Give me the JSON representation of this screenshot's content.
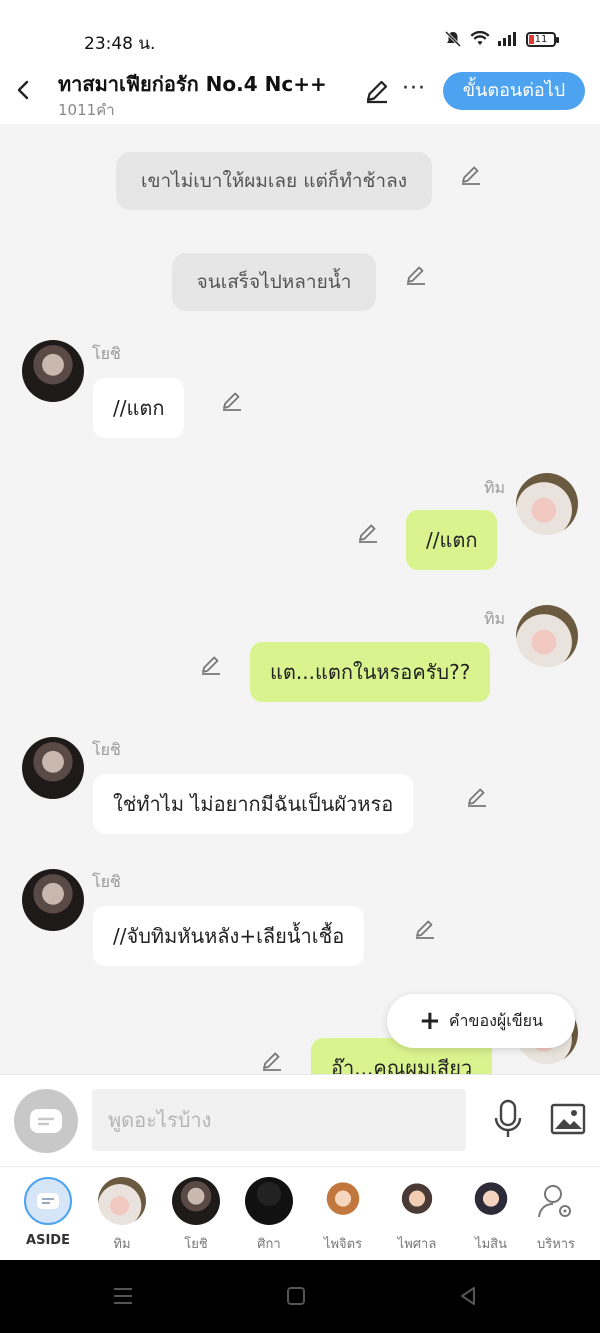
{
  "status_bar": {
    "time": "23:48 น.",
    "battery": "11"
  },
  "header": {
    "title": "ทาสมาเฟียก่อรัก No.4 Nc++",
    "word_count": "1011คำ",
    "next_button": "ขั้นตอนต่อไป"
  },
  "colors": {
    "accent": "#4ea3f1",
    "bubble_right": "#d9f38f",
    "narration": "#e6e6e6"
  },
  "messages": [
    {
      "type": "narration",
      "text": "เขาไม่เบาให้ผมเลย แต่ก็ทำช้าลง"
    },
    {
      "type": "narration",
      "text": "จนเสร็จไปหลายน้ำ"
    },
    {
      "type": "left",
      "name": "โยชิ",
      "text": "//แตก"
    },
    {
      "type": "right",
      "name": "ทิม",
      "text": "//แตก"
    },
    {
      "type": "right",
      "name": "ทิม",
      "text": "แต...แตกในหรอครับ??"
    },
    {
      "type": "left",
      "name": "โยชิ",
      "text": "ใช่ทำไม ไม่อยากมีฉันเป็นผัวหรอ"
    },
    {
      "type": "left",
      "name": "โยชิ",
      "text": "//จับทิมหันหลัง+เลียน้ำเชื้อ"
    },
    {
      "type": "right",
      "name": "ทิม",
      "text": "อ๊า...คุณผมเสียว"
    }
  ],
  "fab_label": "คำของผู้เขียน",
  "input": {
    "placeholder": "พูดอะไรบ้าง"
  },
  "characters": [
    {
      "label": "ASIDE"
    },
    {
      "label": "ทิม"
    },
    {
      "label": "โยชิ"
    },
    {
      "label": "ศิกา"
    },
    {
      "label": "ไพจิตร"
    },
    {
      "label": "ไพศาล"
    },
    {
      "label": "ไมสิน"
    },
    {
      "label": "บริหาร"
    }
  ],
  "icons": [
    "back-arrow-icon",
    "pencil-icon",
    "more-icon",
    "mic-icon",
    "image-icon",
    "aside-icon",
    "manage-icon"
  ]
}
